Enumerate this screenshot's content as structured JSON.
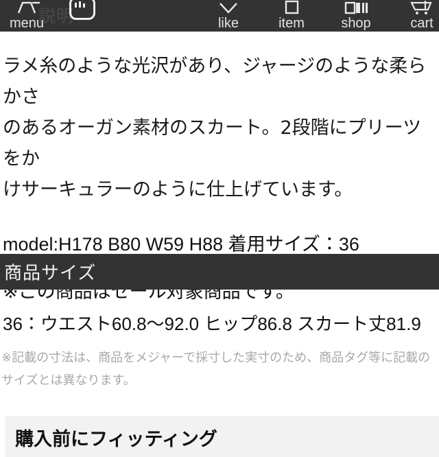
{
  "navbar": {
    "background": "#333333",
    "ghost_text": "説明",
    "items": [
      {
        "label": "menu",
        "icon": "hamburger-menu-icon"
      },
      {
        "label": "like",
        "icon": "chevron-down-icon"
      },
      {
        "label": "item",
        "icon": "square-outline-icon"
      },
      {
        "label": "shop",
        "icon": "shop-bars-icon"
      },
      {
        "label": "cart",
        "icon": "shopping-cart-icon"
      }
    ],
    "logo": {
      "icon": "brand-logo-icon"
    }
  },
  "description": {
    "line1": "ラメ糸のような光沢があり、ジャージのような柔らかさ",
    "line2": "のあるオーガン素材のスカート。2段階にプリーツをか",
    "line3": "けサーキュラーのように仕上げています。"
  },
  "model": {
    "text": "model:H178 B80 W59 H88 着用サイズ：36"
  },
  "sale_notice": {
    "text": "※この商品はセール対象商品です。"
  },
  "size_section": {
    "header": "商品サイズ",
    "measurement": "36：ウエスト60.8〜92.0 ヒップ86.8 スカート丈81.9",
    "note_line1": "※記載の寸法は、商品をメジャーで採寸した実寸のため、商品タグ等に記載の",
    "note_line2": "サイズとは異なります。"
  },
  "bottom_card": {
    "title": "購入前にフィッティング"
  },
  "colors": {
    "nav_background": "#333333",
    "section_header_background": "#333333",
    "body_text": "#111111",
    "note_text": "#a8a8a8",
    "card_background": "#f2f2f2"
  }
}
